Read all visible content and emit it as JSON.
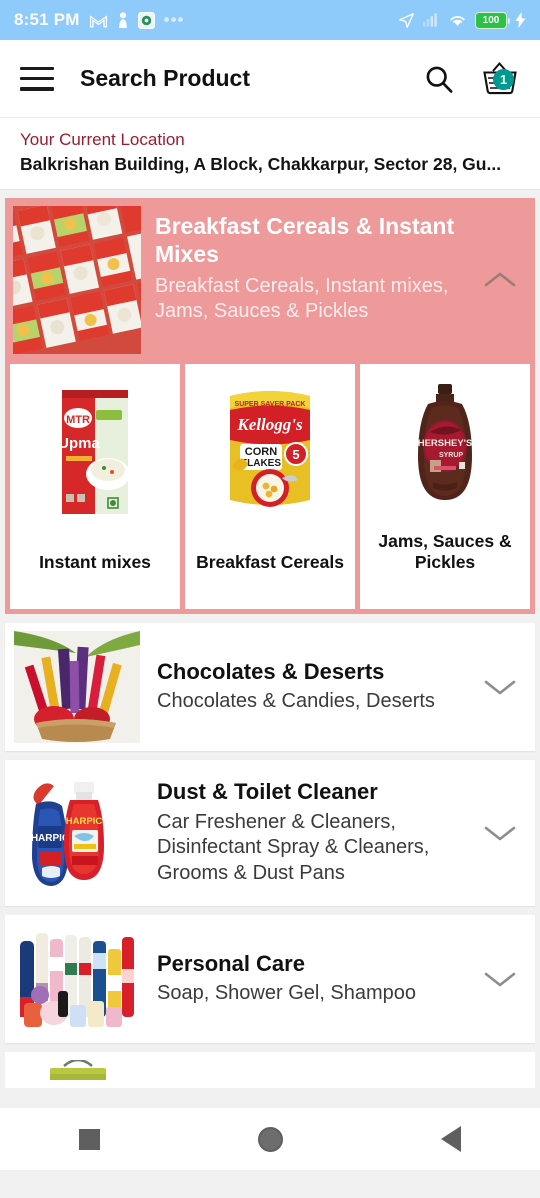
{
  "status_bar": {
    "time": "8:51 PM",
    "battery": "100",
    "left_icons": [
      "gmail-icon",
      "person-icon",
      "app-icon",
      "overflow-dots-icon"
    ],
    "right_icons": [
      "location-arrow-icon",
      "signal-icon",
      "wifi-icon",
      "battery-icon",
      "charging-bolt-icon"
    ],
    "bg_color": "#8ecafa"
  },
  "appbar": {
    "title": "Search Product",
    "menu_icon": "hamburger-menu-icon",
    "search_icon": "search-icon",
    "cart_icon": "shopping-basket-icon",
    "cart_count": "1",
    "badge_color": "#00998f"
  },
  "location": {
    "label": "Your Current Location",
    "address": "Balkrishan Building, A Block, Chakkarpur, Sector 28, Gu...",
    "label_color": "#9b1c30"
  },
  "expanded_category": {
    "title": "Breakfast Cereals & Instant Mixes",
    "subtitle": "Breakfast Cereals, Instant mixes, Jams, Sauces & Pickles",
    "chevron": "chevron-up-icon",
    "bg_color": "#ee9a9b",
    "thumb_alt": "cereal-packets-grid-image",
    "subcategories": [
      {
        "label": "Instant mixes",
        "image_alt": "mtr-upma-packet-image"
      },
      {
        "label": "Breakfast Cereals",
        "image_alt": "kelloggs-corn-flakes-pack-image"
      },
      {
        "label": "Jams, Sauces & Pickles",
        "image_alt": "hersheys-syrup-bottle-image"
      }
    ]
  },
  "categories": [
    {
      "title": "Chocolates & Deserts",
      "subtitle": "Chocolates & Candies, Deserts",
      "chevron": "chevron-down-icon",
      "thumb_alt": "chocolate-bouquet-basket-image"
    },
    {
      "title": "Dust & Toilet Cleaner",
      "subtitle": "Car Freshener & Cleaners, Disinfectant Spray & Cleaners, Grooms & Dust Pans",
      "chevron": "chevron-down-icon",
      "thumb_alt": "harpic-cleaner-bottles-image"
    },
    {
      "title": "Personal Care",
      "subtitle": "Soap, Shower Gel, Shampoo",
      "chevron": "chevron-down-icon",
      "thumb_alt": "personal-care-products-collage-image"
    }
  ],
  "nav_bar": {
    "recents": "recents-square-icon",
    "home": "home-circle-icon",
    "back": "back-triangle-icon"
  }
}
